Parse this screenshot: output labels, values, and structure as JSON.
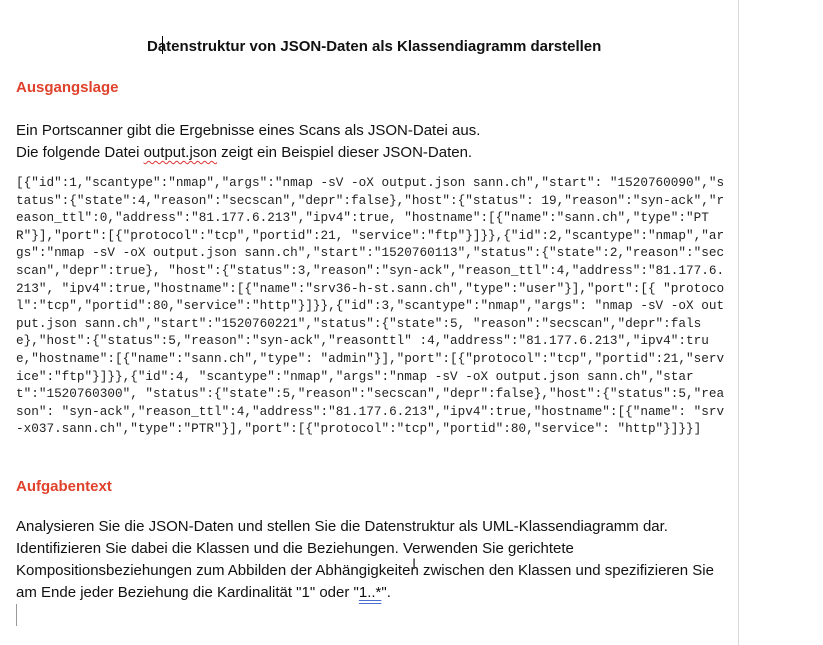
{
  "document": {
    "title": "Datenstruktur von JSON-Daten als Klassendiagramm darstellen",
    "section1_heading": "Ausgangslage",
    "intro_line1": "Ein Portscanner gibt die Ergebnisse eines Scans als JSON-Datei aus.",
    "intro_line2_pre": "Die folgende Datei ",
    "intro_line2_file": "output.json",
    "intro_line2_post": " zeigt ein Beispiel dieser JSON-Daten.",
    "json_text": "[{\"id\":1,\"scantype\":\"nmap\",\"args\":\"nmap -sV -oX output.json sann.ch\",\"start\": \"1520760090\",\"status\":{\"state\":4,\"reason\":\"secscan\",\"depr\":false},\"host\":{\"status\": 19,\"reason\":\"syn-ack\",\"reason_ttl\":0,\"address\":\"81.177.6.213\",\"ipv4\":true, \"hostname\":[{\"name\":\"sann.ch\",\"type\":\"PTR\"}],\"port\":[{\"protocol\":\"tcp\",\"portid\":21, \"service\":\"ftp\"}]}},{\"id\":2,\"scantype\":\"nmap\",\"args\":\"nmap -sV -oX output.json sann.ch\",\"start\":\"1520760113\",\"status\":{\"state\":2,\"reason\":\"secscan\",\"depr\":true}, \"host\":{\"status\":3,\"reason\":\"syn-ack\",\"reason_ttl\":4,\"address\":\"81.177.6.213\", \"ipv4\":true,\"hostname\":[{\"name\":\"srv36-h-st.sann.ch\",\"type\":\"user\"}],\"port\":[{ \"protocol\":\"tcp\",\"portid\":80,\"service\":\"http\"}]}},{\"id\":3,\"scantype\":\"nmap\",\"args\": \"nmap -sV -oX output.json sann.ch\",\"start\":\"1520760221\",\"status\":{\"state\":5, \"reason\":\"secscan\",\"depr\":false},\"host\":{\"status\":5,\"reason\":\"syn-ack\",\"reasonttl\" :4,\"address\":\"81.177.6.213\",\"ipv4\":true,\"hostname\":[{\"name\":\"sann.ch\",\"type\": \"admin\"}],\"port\":[{\"protocol\":\"tcp\",\"portid\":21,\"service\":\"ftp\"}]}},{\"id\":4, \"scantype\":\"nmap\",\"args\":\"nmap -sV -oX output.json sann.ch\",\"start\":\"1520760300\", \"status\":{\"state\":5,\"reason\":\"secscan\",\"depr\":false},\"host\":{\"status\":5,\"reason\": \"syn-ack\",\"reason_ttl\":4,\"address\":\"81.177.6.213\",\"ipv4\":true,\"hostname\":[{\"name\": \"srv-x037.sann.ch\",\"type\":\"PTR\"}],\"port\":[{\"protocol\":\"tcp\",\"portid\":80,\"service\": \"http\"}]}}]",
    "section2_heading": "Aufgabentext",
    "task_line1": "Analysieren Sie die JSON-Daten und stellen Sie die Datenstruktur als UML-Klassendiagramm dar.",
    "task_line2": "Identifizieren Sie dabei die Klassen und die Beziehungen. Verwenden Sie gerichtete",
    "task_line3": "Kompositionsbeziehungen zum Abbilden der Abhängigkeiten zwischen den Klassen und spezifizieren Sie",
    "task_line4_pre": "am Ende jeder Beziehung die Kardinalität \"1\" oder \"",
    "task_line4_mult": "1..*",
    "task_line4_post": "\"."
  }
}
